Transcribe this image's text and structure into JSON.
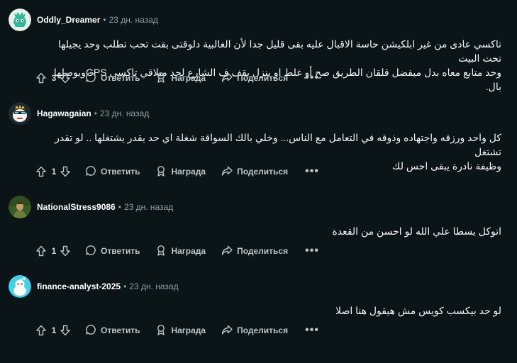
{
  "comments": [
    {
      "author": "Oddly_Dreamer",
      "time": "23 дн. назад",
      "body": [
        "تاكسي عادى من غير ابلكيشن حاسة الاقبال عليه بقى قليل جدا لأن الغالبية دلوقتى بقت تحب تطلب وحد يجيلها تحت البيت",
        "وحد متابع معاه بدل ميفضل قلقان الطريق صح أو غلط او ينزل يقف ف الشارع لحد ميلاقي تاكسي GPSويوصلها بال."
      ],
      "votes": "3",
      "reply_label": "Ответить",
      "award_label": "Награда",
      "share_label": "Поделиться",
      "more_label": "•••"
    },
    {
      "author": "Hagawagaian",
      "time": "23 дн. назад",
      "body": [
        "كل واحد ورزقه واجتهاده وذوقه في التعامل مع الناس... وخلي بالك السواقة شغلة اي حد يقدر يشتغلها .. لو تقدر تشتغل",
        "وظيفة نادرة يبقى احس لك"
      ],
      "votes": "1",
      "reply_label": "Ответить",
      "award_label": "Награда",
      "share_label": "Поделиться",
      "more_label": "•••"
    },
    {
      "author": "NationalStress9086",
      "time": "23 дн. назад",
      "body": [
        "اتوكل يسطا علي الله لو احسن من القعدة"
      ],
      "votes": "1",
      "reply_label": "Ответить",
      "award_label": "Награда",
      "share_label": "Поделиться",
      "more_label": "•••"
    },
    {
      "author": "finance-analyst-2025",
      "time": "23 дн. назад",
      "body": [
        "لو حد بيكسب كويس مش هيقول هنا اصلا"
      ],
      "votes": "1",
      "reply_label": "Ответить",
      "award_label": "Награда",
      "share_label": "Поделиться",
      "more_label": "•••"
    }
  ],
  "separator": "•",
  "colors": {
    "background": "#0b1416",
    "text": "#f2f4f5",
    "muted": "#8ba2ad"
  },
  "icons": {
    "upvote": "upvote-arrow-icon",
    "downvote": "downvote-arrow-icon",
    "reply": "speech-bubble-icon",
    "award": "award-ribbon-icon",
    "share": "share-arrow-icon",
    "more": "ellipsis-icon"
  }
}
